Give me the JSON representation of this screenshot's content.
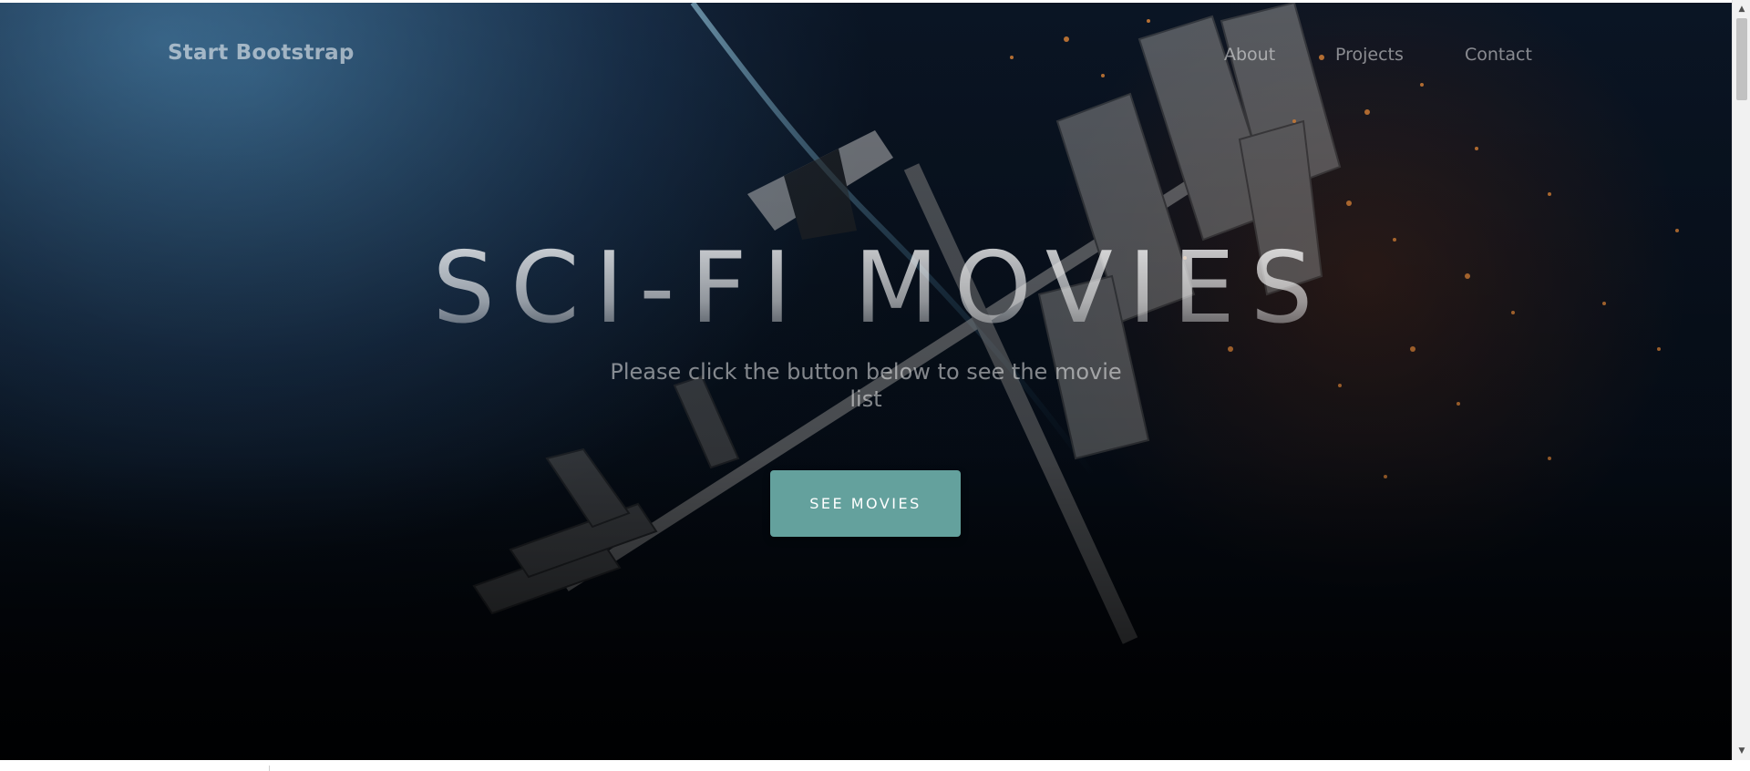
{
  "navbar": {
    "brand": "Start Bootstrap",
    "links": [
      {
        "label": "About"
      },
      {
        "label": "Projects"
      },
      {
        "label": "Contact"
      }
    ]
  },
  "hero": {
    "title": "SCI-FI MOVIES",
    "subtitle": "Please click the button below to see the movie list",
    "button_label": "SEE MOVIES"
  },
  "colors": {
    "accent": "#64a19d",
    "hero_bg": "#07101c"
  },
  "icons": [
    "scroll-up-arrow-icon",
    "scroll-down-arrow-icon"
  ]
}
